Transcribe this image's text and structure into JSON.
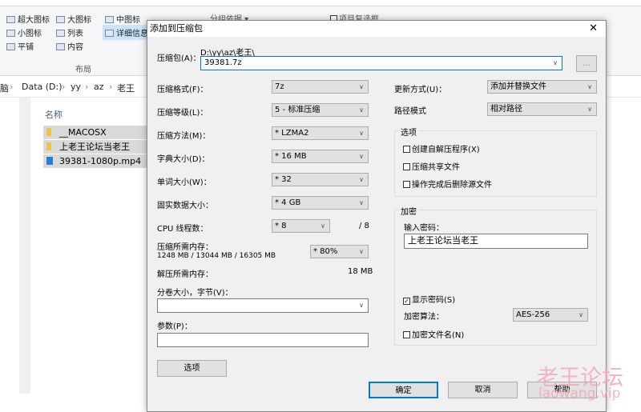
{
  "explorer": {
    "ribbon": {
      "layout_items": [
        "超大图标",
        "大图标",
        "中图标",
        "小图标",
        "列表",
        "详细信息",
        "平铺",
        "内容"
      ],
      "group_label": "布局",
      "group_by": "分组依据 ▾",
      "item_checkbox": "项目复选框"
    },
    "breadcrumb": [
      "脑",
      "Data (D:)",
      "yy",
      "az",
      "老王"
    ],
    "column_name": "名称",
    "files": [
      {
        "name": "__MACOSX",
        "type": "folder"
      },
      {
        "name": "上老王论坛当老王",
        "type": "folder"
      },
      {
        "name": "39381-1080p.mp4",
        "type": "video"
      }
    ]
  },
  "dialog": {
    "title": "添加到压缩包",
    "archive_label": "压缩包(A)：",
    "archive_path": "D:\\yy\\az\\老王\\",
    "archive_name": "39381.7z",
    "browse": "...",
    "format": {
      "label": "压缩格式(F)：",
      "value": "7z"
    },
    "level": {
      "label": "压缩等级(L)：",
      "value": "5 - 标准压缩"
    },
    "method": {
      "label": "压缩方法(M)：",
      "value": "* LZMA2"
    },
    "dict": {
      "label": "字典大小(D)：",
      "value": "* 16 MB"
    },
    "word": {
      "label": "单词大小(W)：",
      "value": "* 32"
    },
    "solid": {
      "label": "固实数据大小：",
      "value": "* 4 GB"
    },
    "cpu": {
      "label": "CPU 线程数：",
      "value": "* 8",
      "max": "/ 8"
    },
    "mem": {
      "label": "压缩所需内存：",
      "detail": "1248 MB / 13044 MB / 16305 MB",
      "value": "* 80%"
    },
    "decomp": {
      "label": "解压所需内存：",
      "value": "18 MB"
    },
    "split": {
      "label": "分卷大小，字节(V)：",
      "value": ""
    },
    "params": {
      "label": "参数(P)：",
      "value": ""
    },
    "options_btn": "选项",
    "update": {
      "label": "更新方式(U)：",
      "value": "添加并替换文件"
    },
    "pathmode": {
      "label": "路径模式",
      "value": "相对路径"
    },
    "options": {
      "title": "选项",
      "items": [
        {
          "label": "创建自解压程序(X)",
          "checked": false
        },
        {
          "label": "压缩共享文件",
          "checked": false
        },
        {
          "label": "操作完成后删除源文件",
          "checked": false
        }
      ]
    },
    "encrypt": {
      "title": "加密",
      "pw_label": "输入密码：",
      "password": "上老王论坛当老王",
      "show_pw": {
        "label": "显示密码(S)",
        "checked": true
      },
      "algo_label": "加密算法：",
      "algo": "AES-256",
      "enc_names": {
        "label": "加密文件名(N)",
        "checked": false
      }
    },
    "ok": "确定",
    "cancel": "取消",
    "help": "帮助"
  },
  "watermark": {
    "cn": "老王论坛",
    "url": "laowang.vip"
  }
}
